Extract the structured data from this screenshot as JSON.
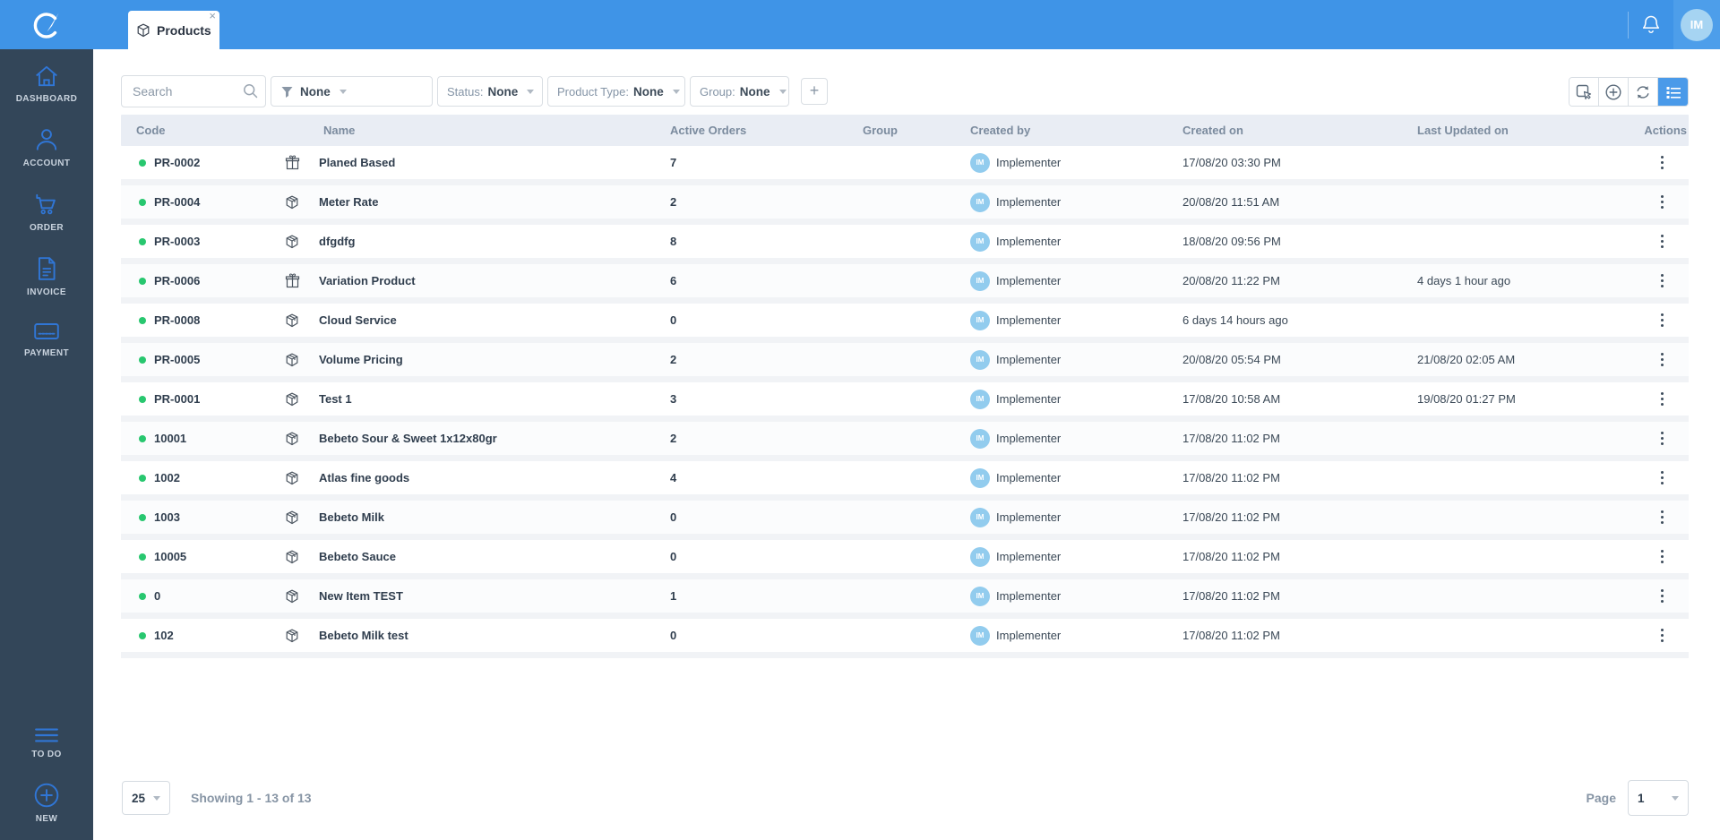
{
  "topbar": {
    "tab": {
      "label": "Products",
      "close": "×"
    },
    "avatar_initials": "IM"
  },
  "sidebar": {
    "items": [
      {
        "label": "DASHBOARD",
        "icon": "home-icon"
      },
      {
        "label": "ACCOUNT",
        "icon": "user-icon"
      },
      {
        "label": "ORDER",
        "icon": "cart-icon"
      },
      {
        "label": "INVOICE",
        "icon": "invoice-icon"
      },
      {
        "label": "PAYMENT",
        "icon": "credit-card-icon"
      }
    ],
    "footer_items": [
      {
        "label": "TO DO",
        "icon": "menu-icon"
      },
      {
        "label": "NEW",
        "icon": "plus-circle-icon"
      }
    ]
  },
  "filters": {
    "search_placeholder": "Search",
    "filter_dropdown": {
      "value": "None"
    },
    "chips": [
      {
        "label": "Status:",
        "value": "None"
      },
      {
        "label": "Product Type:",
        "value": "None"
      },
      {
        "label": "Group:",
        "value": "None"
      }
    ],
    "add_button": "+"
  },
  "view_toolbar": {
    "buttons": [
      "select-mode",
      "add-new",
      "refresh",
      "list-view"
    ],
    "active": "list-view"
  },
  "table": {
    "columns": [
      "Code",
      "Name",
      "Active Orders",
      "Group",
      "Created by",
      "Created on",
      "Last Updated on",
      "Actions"
    ],
    "rows": [
      {
        "status": "active",
        "code": "PR-0002",
        "icon": "gift",
        "name": "Planed Based",
        "active_orders": "7",
        "group": "",
        "created_by": {
          "initials": "IM",
          "name": "Implementer"
        },
        "created_on": "17/08/20 03:30 PM",
        "last_updated_on": ""
      },
      {
        "status": "active",
        "code": "PR-0004",
        "icon": "box",
        "name": "Meter Rate",
        "active_orders": "2",
        "group": "",
        "created_by": {
          "initials": "IM",
          "name": "Implementer"
        },
        "created_on": "20/08/20 11:51 AM",
        "last_updated_on": ""
      },
      {
        "status": "active",
        "code": "PR-0003",
        "icon": "box",
        "name": "dfgdfg",
        "active_orders": "8",
        "group": "",
        "created_by": {
          "initials": "IM",
          "name": "Implementer"
        },
        "created_on": "18/08/20 09:56 PM",
        "last_updated_on": ""
      },
      {
        "status": "active",
        "code": "PR-0006",
        "icon": "gift",
        "name": "Variation Product",
        "active_orders": "6",
        "group": "",
        "created_by": {
          "initials": "IM",
          "name": "Implementer"
        },
        "created_on": "20/08/20 11:22 PM",
        "last_updated_on": "4 days 1 hour ago"
      },
      {
        "status": "active",
        "code": "PR-0008",
        "icon": "box",
        "name": "Cloud Service",
        "active_orders": "0",
        "group": "",
        "created_by": {
          "initials": "IM",
          "name": "Implementer"
        },
        "created_on": "6 days 14 hours ago",
        "last_updated_on": ""
      },
      {
        "status": "active",
        "code": "PR-0005",
        "icon": "box",
        "name": "Volume Pricing",
        "active_orders": "2",
        "group": "",
        "created_by": {
          "initials": "IM",
          "name": "Implementer"
        },
        "created_on": "20/08/20 05:54 PM",
        "last_updated_on": "21/08/20 02:05 AM"
      },
      {
        "status": "active",
        "code": "PR-0001",
        "icon": "box",
        "name": "Test 1",
        "active_orders": "3",
        "group": "",
        "created_by": {
          "initials": "IM",
          "name": "Implementer"
        },
        "created_on": "17/08/20 10:58 AM",
        "last_updated_on": "19/08/20 01:27 PM"
      },
      {
        "status": "active",
        "code": "10001",
        "icon": "box",
        "name": "Bebeto Sour & Sweet 1x12x80gr",
        "active_orders": "2",
        "group": "",
        "created_by": {
          "initials": "IM",
          "name": "Implementer"
        },
        "created_on": "17/08/20 11:02 PM",
        "last_updated_on": ""
      },
      {
        "status": "active",
        "code": "1002",
        "icon": "box",
        "name": "Atlas fine goods",
        "active_orders": "4",
        "group": "",
        "created_by": {
          "initials": "IM",
          "name": "Implementer"
        },
        "created_on": "17/08/20 11:02 PM",
        "last_updated_on": ""
      },
      {
        "status": "active",
        "code": "1003",
        "icon": "box",
        "name": "Bebeto Milk",
        "active_orders": "0",
        "group": "",
        "created_by": {
          "initials": "IM",
          "name": "Implementer"
        },
        "created_on": "17/08/20 11:02 PM",
        "last_updated_on": ""
      },
      {
        "status": "active",
        "code": "10005",
        "icon": "box",
        "name": "Bebeto Sauce",
        "active_orders": "0",
        "group": "",
        "created_by": {
          "initials": "IM",
          "name": "Implementer"
        },
        "created_on": "17/08/20 11:02 PM",
        "last_updated_on": ""
      },
      {
        "status": "active",
        "code": "0",
        "icon": "box",
        "name": "New Item TEST",
        "active_orders": "1",
        "group": "",
        "created_by": {
          "initials": "IM",
          "name": "Implementer"
        },
        "created_on": "17/08/20 11:02 PM",
        "last_updated_on": ""
      },
      {
        "status": "active",
        "code": "102",
        "icon": "box",
        "name": "Bebeto Milk test",
        "active_orders": "0",
        "group": "",
        "created_by": {
          "initials": "IM",
          "name": "Implementer"
        },
        "created_on": "17/08/20 11:02 PM",
        "last_updated_on": ""
      }
    ]
  },
  "pagination": {
    "page_size": "25",
    "showing_text": "Showing 1 - 13 of 13",
    "page_label": "Page",
    "page_value": "1"
  },
  "colors": {
    "accent": "#3f94e7",
    "sidebar_bg": "#334659",
    "status_green": "#28c76f",
    "header_bg": "#e9edf4",
    "avatar_bg": "#92ccee"
  }
}
